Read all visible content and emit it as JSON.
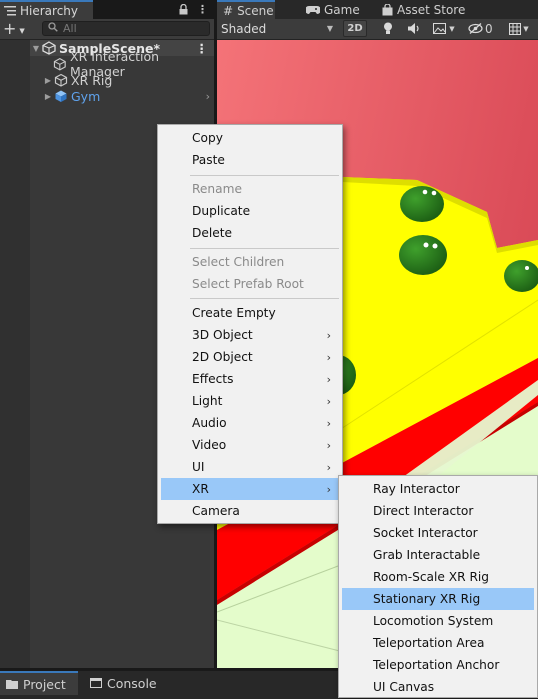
{
  "hierarchy": {
    "tab_label": "Hierarchy",
    "lock_icon": "lock-icon",
    "menu_icon": "kebab-menu-icon",
    "add_label": "+",
    "search_placeholder": "All",
    "items": [
      {
        "label": "SampleScene*",
        "icon": "unity-scene-icon",
        "expanded": true
      },
      {
        "label": "XR Interaction Manager",
        "icon": "gameobject-cube-icon"
      },
      {
        "label": "XR Rig",
        "icon": "gameobject-cube-icon",
        "collapsed": true
      },
      {
        "label": "Gym",
        "icon": "prefab-cube-icon",
        "collapsed": true,
        "color": "#5fa2ec"
      }
    ]
  },
  "scene_view": {
    "tabs": [
      {
        "label": "Scene",
        "icon": "hash-icon",
        "active": true
      },
      {
        "label": "Game",
        "icon": "gamepad-icon"
      },
      {
        "label": "Asset Store",
        "icon": "shopping-bag-icon"
      }
    ],
    "toolbar": {
      "shading_mode": "Shaded",
      "btn_2d": "2D",
      "light_icon": "lightbulb-icon",
      "audio_icon": "speaker-icon",
      "fx_icon": "image-effects-icon",
      "hidden_count": "0",
      "hidden_icon": "eye-slash-icon",
      "grid_icon": "grid-icon"
    },
    "colors": {
      "wall": "#f0696e",
      "floor": "#ffff00",
      "red_strip": "#ff0000",
      "ground": "#e8ffcc",
      "ball": "#2d8a1e"
    }
  },
  "bottom_tabs": [
    {
      "label": "Project",
      "icon": "folder-icon",
      "active": true
    },
    {
      "label": "Console",
      "icon": "console-icon"
    }
  ],
  "context_menu": {
    "items": [
      {
        "label": "Copy"
      },
      {
        "label": "Paste"
      },
      {
        "label": "Rename",
        "disabled": true
      },
      {
        "label": "Duplicate"
      },
      {
        "label": "Delete"
      },
      {
        "label": "Select Children",
        "disabled": true
      },
      {
        "label": "Select Prefab Root",
        "disabled": true
      },
      {
        "label": "Create Empty"
      },
      {
        "label": "3D Object",
        "submenu": true
      },
      {
        "label": "2D Object",
        "submenu": true
      },
      {
        "label": "Effects",
        "submenu": true
      },
      {
        "label": "Light",
        "submenu": true
      },
      {
        "label": "Audio",
        "submenu": true
      },
      {
        "label": "Video",
        "submenu": true
      },
      {
        "label": "UI",
        "submenu": true
      },
      {
        "label": "XR",
        "submenu": true,
        "highlighted": true
      },
      {
        "label": "Camera"
      }
    ],
    "submenu_arrow": "›"
  },
  "xr_submenu": {
    "items": [
      {
        "label": "Ray Interactor"
      },
      {
        "label": "Direct Interactor"
      },
      {
        "label": "Socket Interactor"
      },
      {
        "label": "Grab Interactable"
      },
      {
        "label": "Room-Scale XR Rig"
      },
      {
        "label": "Stationary XR Rig",
        "highlighted": true
      },
      {
        "label": "Locomotion System"
      },
      {
        "label": "Teleportation Area"
      },
      {
        "label": "Teleportation Anchor"
      },
      {
        "label": "UI Canvas"
      }
    ]
  }
}
